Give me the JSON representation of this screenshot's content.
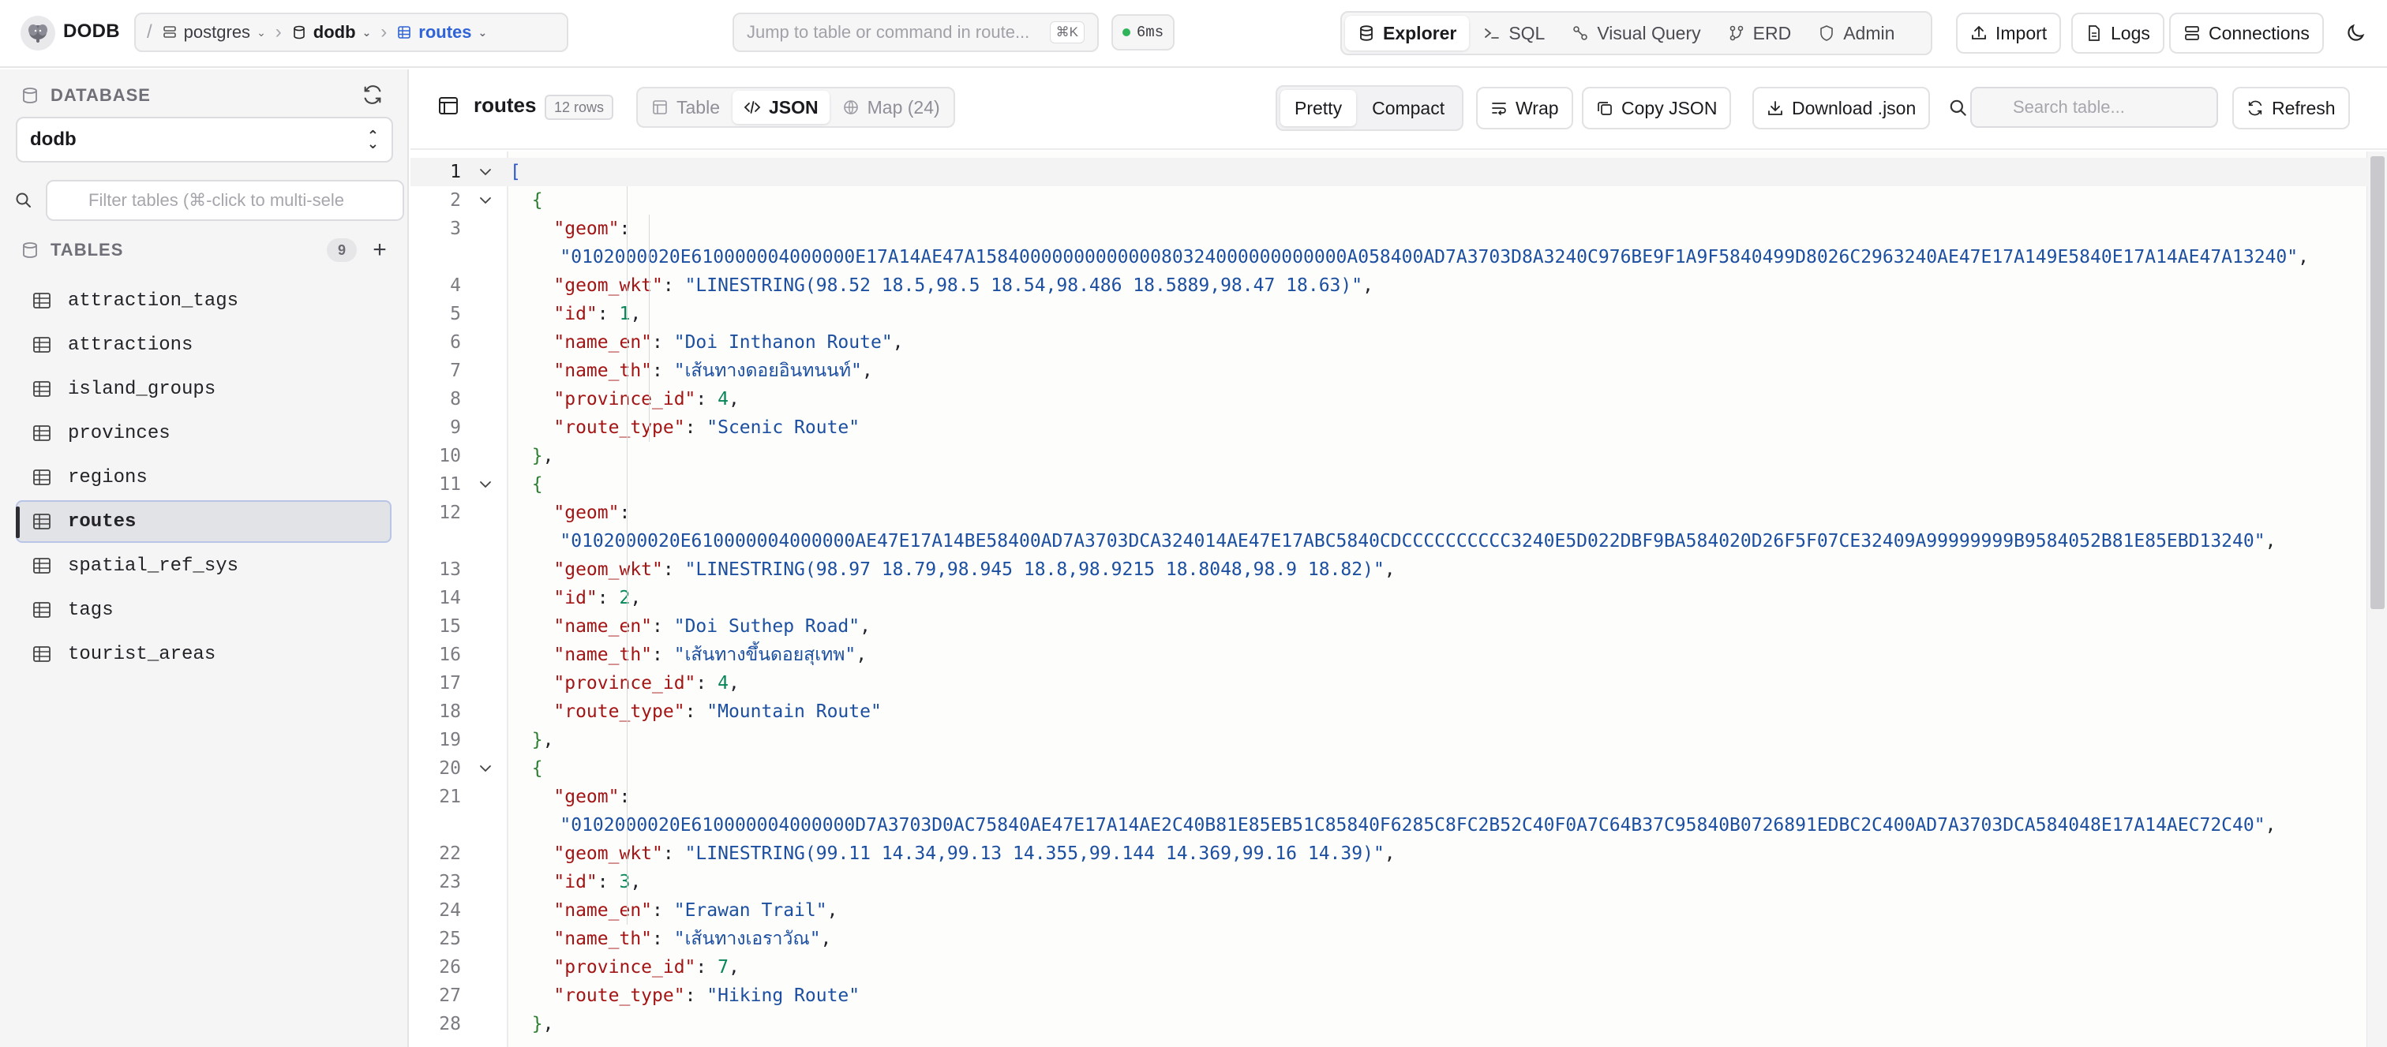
{
  "app": {
    "brand": "DODB"
  },
  "breadcrumb": {
    "server": "postgres",
    "database": "dodb",
    "table": "routes"
  },
  "jump": {
    "placeholder": "Jump to table or command in route...",
    "shortcut": "⌘K"
  },
  "latency": "6ms",
  "modes": [
    {
      "label": "Explorer",
      "icon": "database-icon",
      "active": true
    },
    {
      "label": "SQL",
      "icon": "terminal-icon",
      "active": false
    },
    {
      "label": "Visual Query",
      "icon": "graph-icon",
      "active": false
    },
    {
      "label": "ERD",
      "icon": "erd-icon",
      "active": false
    },
    {
      "label": "Admin",
      "icon": "shield-icon",
      "active": false
    }
  ],
  "topbuttons": {
    "import": "Import",
    "logs": "Logs",
    "connections": "Connections"
  },
  "sidebar": {
    "database_heading": "DATABASE",
    "selected_db": "dodb",
    "filter_placeholder": "Filter tables (⌘-click to multi-sele",
    "tables_heading": "TABLES",
    "tables_count": "9",
    "tables": [
      {
        "name": "attraction_tags",
        "selected": false
      },
      {
        "name": "attractions",
        "selected": false
      },
      {
        "name": "island_groups",
        "selected": false
      },
      {
        "name": "provinces",
        "selected": false
      },
      {
        "name": "regions",
        "selected": false
      },
      {
        "name": "routes",
        "selected": true
      },
      {
        "name": "spatial_ref_sys",
        "selected": false
      },
      {
        "name": "tags",
        "selected": false
      },
      {
        "name": "tourist_areas",
        "selected": false
      }
    ]
  },
  "main": {
    "table_name": "routes",
    "rows_badge": "12 rows",
    "views": [
      {
        "label": "Table",
        "active": false
      },
      {
        "label": "JSON",
        "active": true
      },
      {
        "label": "Map (24)",
        "active": false
      }
    ],
    "format": {
      "pretty": "Pretty",
      "compact": "Compact",
      "active": "Pretty"
    },
    "wrap": "Wrap",
    "copy_json": "Copy JSON",
    "download": "Download .json",
    "search_placeholder": "Search table...",
    "refresh": "Refresh"
  },
  "json_records": [
    {
      "geom": "0102000020E610000004000000E17A14AE47A1584000000000000080324000000000000A058400AD7A3703D8A3240C976BE9F1A9F5840499D8026C2963240AE47E17A149E5840E17A14AE47A13240",
      "geom_wkt": "LINESTRING(98.52 18.5,98.5 18.54,98.486 18.5889,98.47 18.63)",
      "id": 1,
      "name_en": "Doi Inthanon Route",
      "name_th": "เส้นทางดอยอินทนนท์",
      "province_id": 4,
      "route_type": "Scenic Route"
    },
    {
      "geom": "0102000020E610000004000000AE47E17A14BE58400AD7A3703DCA324014AE47E17ABC5840CDCCCCCCCCCC3240E5D022DBF9BA584020D26F5F07CE32409A99999999B9584052B81E85EBD13240",
      "geom_wkt": "LINESTRING(98.97 18.79,98.945 18.8,98.9215 18.8048,98.9 18.82)",
      "id": 2,
      "name_en": "Doi Suthep Road",
      "name_th": "เส้นทางขึ้นดอยสุเทพ",
      "province_id": 4,
      "route_type": "Mountain Route"
    },
    {
      "geom": "0102000020E610000004000000D7A3703D0AC75840AE47E17A14AE2C40B81E85EB51C85840F6285C8FC2B52C40F0A7C64B37C95840B0726891EDBC2C400AD7A3703DCA584048E17A14AEC72C40",
      "geom_wkt": "LINESTRING(99.11 14.34,99.13 14.355,99.144 14.369,99.16 14.39)",
      "id": 3,
      "name_en": "Erawan Trail",
      "name_th": "เส้นทางเอราวัณ",
      "province_id": 7,
      "route_type": "Hiking Route"
    }
  ],
  "colors": {
    "accent": "#2f63d6",
    "key": "#a31515",
    "string": "#1c4fa0",
    "number": "#098658",
    "brace": "#2e7d32",
    "latency_dot": "#2fb45a"
  }
}
